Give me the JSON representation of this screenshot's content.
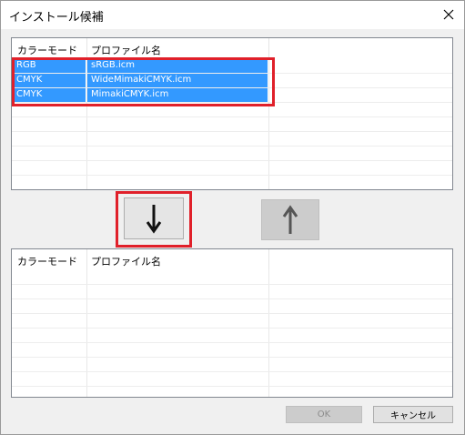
{
  "window": {
    "title": "インストール候補"
  },
  "columns": {
    "color_mode": "カラーモード",
    "profile_name": "プロファイル名"
  },
  "top_list": {
    "rows": [
      {
        "color_mode": "RGB",
        "profile": "sRGB.icm"
      },
      {
        "color_mode": "CMYK",
        "profile": "WideMimakiCMYK.icm"
      },
      {
        "color_mode": "CMYK",
        "profile": "MimakiCMYK.icm"
      }
    ]
  },
  "buttons": {
    "ok": "OK",
    "cancel": "キャンセル"
  },
  "icons": {
    "move_down": "arrow-down-icon",
    "move_up": "arrow-up-icon",
    "close": "close-icon"
  },
  "colors": {
    "selection": "#3399ff",
    "highlight_box": "#e0202a"
  }
}
